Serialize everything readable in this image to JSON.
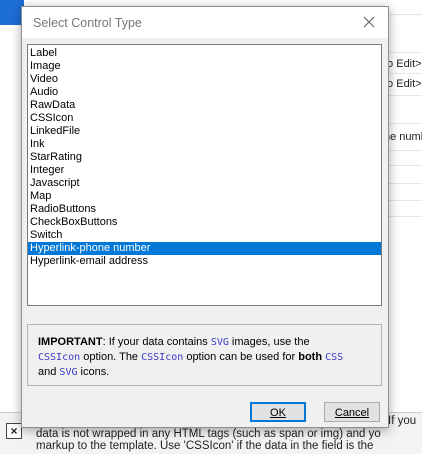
{
  "background": {
    "cell_texts": [
      "to Edit>",
      "to Edit>",
      "ne numb"
    ],
    "help_line_1_right": "If you",
    "help_line_2": "data is not wrapped in any HTML tags (such as span or img) and yo",
    "help_line_3": "markup to the template. Use 'CSSIcon' if the data in the field is the",
    "close_glyph": "×"
  },
  "dialog": {
    "title": "Select Control Type",
    "items": [
      {
        "label": "Label",
        "selected": false
      },
      {
        "label": "Image",
        "selected": false
      },
      {
        "label": "Video",
        "selected": false
      },
      {
        "label": "Audio",
        "selected": false
      },
      {
        "label": "RawData",
        "selected": false
      },
      {
        "label": "CSSIcon",
        "selected": false
      },
      {
        "label": "LinkedFile",
        "selected": false
      },
      {
        "label": "Ink",
        "selected": false
      },
      {
        "label": "StarRating",
        "selected": false
      },
      {
        "label": "Integer",
        "selected": false
      },
      {
        "label": "Javascript",
        "selected": false
      },
      {
        "label": "Map",
        "selected": false
      },
      {
        "label": "RadioButtons",
        "selected": false
      },
      {
        "label": "CheckBoxButtons",
        "selected": false
      },
      {
        "label": "Switch",
        "selected": false
      },
      {
        "label": "Hyperlink-phone number",
        "selected": true
      },
      {
        "label": "Hyperlink-email address",
        "selected": false
      }
    ],
    "notice": {
      "important": "IMPORTANT",
      "t1": ": If your data contains ",
      "c1": "SVG",
      "t2": " images, use the",
      "c2": "CSSIcon",
      "t3": " option. The ",
      "c3": "CSSIcon",
      "t4": " option can be used for ",
      "b1": "both",
      "t5": " ",
      "c4": "CSS",
      "t6": "and ",
      "c5": "SVG",
      "t7": " icons."
    },
    "ok_label": "OK",
    "cancel_label": "Cancel"
  },
  "colors": {
    "selection": "#0078d7",
    "code_text": "#3a3ac8",
    "app_accent": "#1d6fd6"
  }
}
